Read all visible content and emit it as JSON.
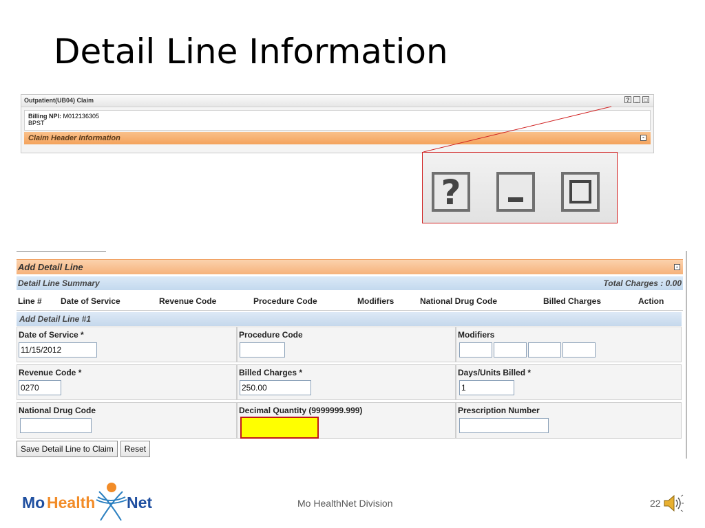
{
  "slide": {
    "title": "Detail Line Information",
    "footer": "Mo HealthNet Division",
    "page_number": "22",
    "logo_text": "MoHealthNet"
  },
  "claim_panel": {
    "title": "Outpatient(UB04) Claim",
    "billing_npi_label": "Billing NPI:",
    "billing_npi_value": "M012136305",
    "provider_name": "BPST",
    "header_section": "Claim Header Information",
    "window_icons": [
      "help-icon",
      "minimize-icon",
      "maximize-icon"
    ]
  },
  "zoom_callout": {
    "help_glyph": "?"
  },
  "detail_panel": {
    "section_title": "Add Detail Line",
    "summary_title": "Detail Line Summary",
    "total_charges": "Total Charges : 0.00",
    "columns": [
      "Line #",
      "Date of Service",
      "Revenue Code",
      "Procedure Code",
      "Modifiers",
      "National Drug Code",
      "Billed Charges",
      "Action"
    ],
    "add_line_title": "Add Detail Line #1",
    "fields": {
      "date_of_service": {
        "label": "Date of Service *",
        "value": "11/15/2012"
      },
      "procedure_code": {
        "label": "Procedure Code",
        "value": ""
      },
      "modifiers": {
        "label": "Modifiers",
        "values": [
          "",
          "",
          "",
          ""
        ]
      },
      "revenue_code": {
        "label": "Revenue Code *",
        "value": "0270"
      },
      "billed_charges": {
        "label": "Billed Charges *",
        "value": "250.00"
      },
      "days_units": {
        "label": "Days/Units Billed *",
        "value": "1"
      },
      "ndc": {
        "label": "National Drug Code",
        "value": ""
      },
      "decimal_quantity": {
        "label": "Decimal Quantity (9999999.999)",
        "value": ""
      },
      "prescription_number": {
        "label": "Prescription Number",
        "value": ""
      }
    },
    "save_button": "Save Detail Line to Claim",
    "reset_button": "Reset"
  },
  "colors": {
    "orange_bar": "#f6b27b",
    "blue_bar": "#c3d9ee",
    "highlight": "#ffff00",
    "callout_red": "#d02020"
  }
}
